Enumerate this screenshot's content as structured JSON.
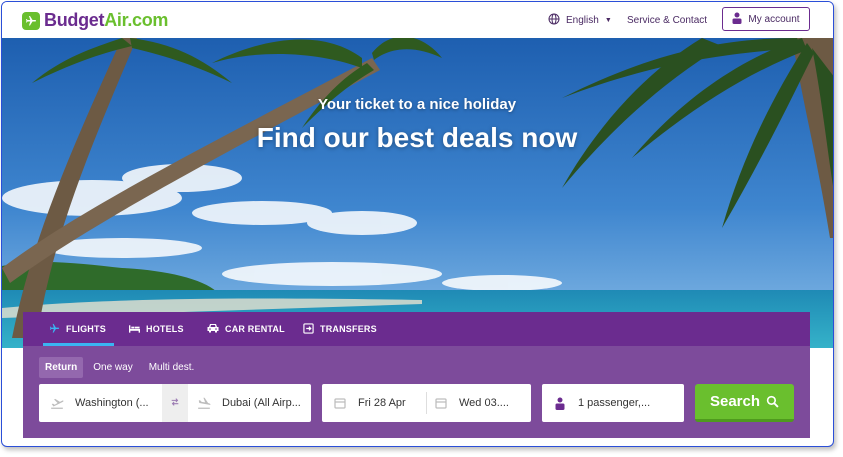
{
  "brand": {
    "name_part1": "Budget",
    "name_part2": "Air.com",
    "logo_color": "#6abf2e",
    "primary_color": "#6b2c8f"
  },
  "header": {
    "language": "English",
    "service_contact": "Service & Contact",
    "my_account": "My account"
  },
  "hero": {
    "subtitle": "Your ticket to a nice holiday",
    "title": "Find our best deals now"
  },
  "tabs": [
    {
      "label": "FLIGHTS",
      "icon": "plane-icon",
      "active": true
    },
    {
      "label": "HOTELS",
      "icon": "bed-icon",
      "active": false
    },
    {
      "label": "CAR RENTAL",
      "icon": "car-icon",
      "active": false
    },
    {
      "label": "TRANSFERS",
      "icon": "transfer-icon",
      "active": false
    }
  ],
  "trip_modes": [
    {
      "label": "Return",
      "active": true
    },
    {
      "label": "One way",
      "active": false
    },
    {
      "label": "Multi dest.",
      "active": false
    }
  ],
  "search_form": {
    "origin": "Washington (...",
    "destination": "Dubai (All Airp...",
    "depart_date": "Fri 28 Apr",
    "return_date": "Wed 03....",
    "passengers": "1 passenger,...",
    "search_label": "Search"
  }
}
